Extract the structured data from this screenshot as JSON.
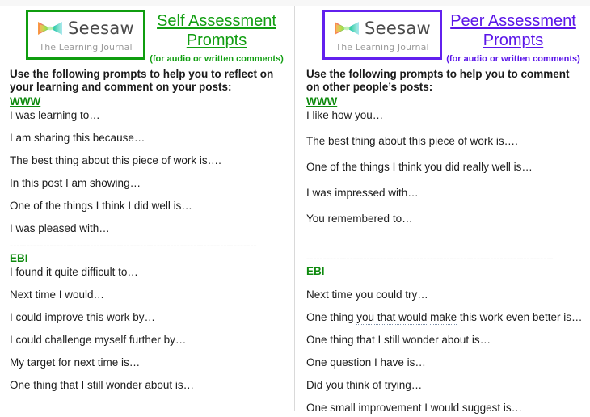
{
  "document": {
    "background_color": "#ffffff",
    "columns": [
      {
        "id": "self-assessment",
        "accent_color": "#119e11",
        "logo": {
          "word": "Seesaw",
          "tagline": "The Learning Journal",
          "icon": "seesaw-bowtie-icon"
        },
        "title": "Self Assessment\nPrompts",
        "subtitle": "(for audio or written comments)",
        "intro": "Use the following prompts to help you to reflect on your learning and comment on your posts:",
        "sections": [
          {
            "label": "WWW",
            "prompts": [
              "I was learning to…",
              "I am sharing this because…",
              "The best thing about this piece of work is….",
              "In this post I am showing…",
              "One of the things I think I did well is…",
              "I was pleased with…"
            ]
          },
          {
            "label": "EBI",
            "prompts": [
              "I found it quite difficult to…",
              "Next time I would…",
              "I could improve this work by…",
              "I could challenge myself further by…",
              "My target for next time is…",
              "One thing that I still wonder about is…"
            ]
          }
        ],
        "divider": "--------------------------------------------------------------------------"
      },
      {
        "id": "peer-assessment",
        "accent_color": "#5b16e8",
        "logo": {
          "word": "Seesaw",
          "tagline": "The Learning Journal",
          "icon": "seesaw-bowtie-icon"
        },
        "title": "Peer Assessment\nPrompts",
        "subtitle": "(for audio or written comments)",
        "intro": "Use the following prompts to help you to comment on other people’s posts:",
        "sections": [
          {
            "label": "WWW",
            "prompts": [
              "I like how you…",
              "The best thing about this piece of work is….",
              "One of the things I think you did really well is…",
              "I was impressed with…",
              "You remembered to…"
            ]
          },
          {
            "label": "EBI",
            "prompts": [
              "Next time you could try…",
              "One thing you that would make this work even better is…",
              "One thing that I still wonder about is…",
              "One question I have is…",
              "Did you think of trying…",
              "One small improvement I would suggest is…"
            ]
          }
        ],
        "divider": "--------------------------------------------------------------------------",
        "spellcheck_fragments": {
          "prefix": "One thing ",
          "flagged_a": "you that would",
          "middle": " ",
          "flagged_b": "make",
          "suffix": " this work even better is…"
        }
      }
    ]
  }
}
